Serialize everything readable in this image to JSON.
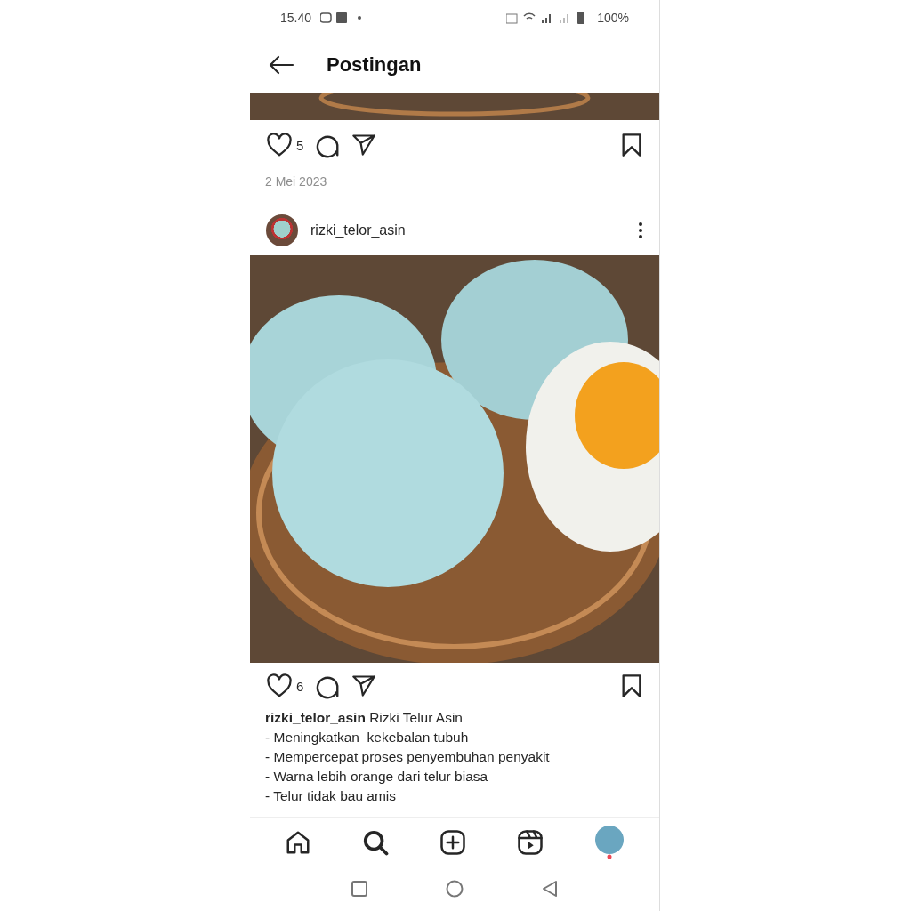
{
  "status_bar": {
    "time": "15.40",
    "battery": "100%"
  },
  "header": {
    "title": "Postingan"
  },
  "posts": [
    {
      "kind": "partial",
      "likes": "5",
      "liked": false,
      "saved": false,
      "date": "2 Mei 2023"
    },
    {
      "kind": "full",
      "user": "rizki_telor_asin",
      "likes": "6",
      "liked": false,
      "saved": false,
      "caption": [
        "**rizki_telor_asin** Rizki Telur Asin",
        "- Meningkatkan  kekebalan tubuh",
        "- Mempercepat proses penyembuhan penyakit",
        "- Warna lebih orange dari telur biasa",
        "- Telur tidak bau amis"
      ]
    }
  ],
  "nav": [
    {
      "kind": "home",
      "selected": false
    },
    {
      "kind": "search",
      "selected": true
    },
    {
      "kind": "create",
      "selected": false
    },
    {
      "kind": "reels",
      "selected": false
    },
    {
      "kind": "profile",
      "selected": false
    }
  ]
}
